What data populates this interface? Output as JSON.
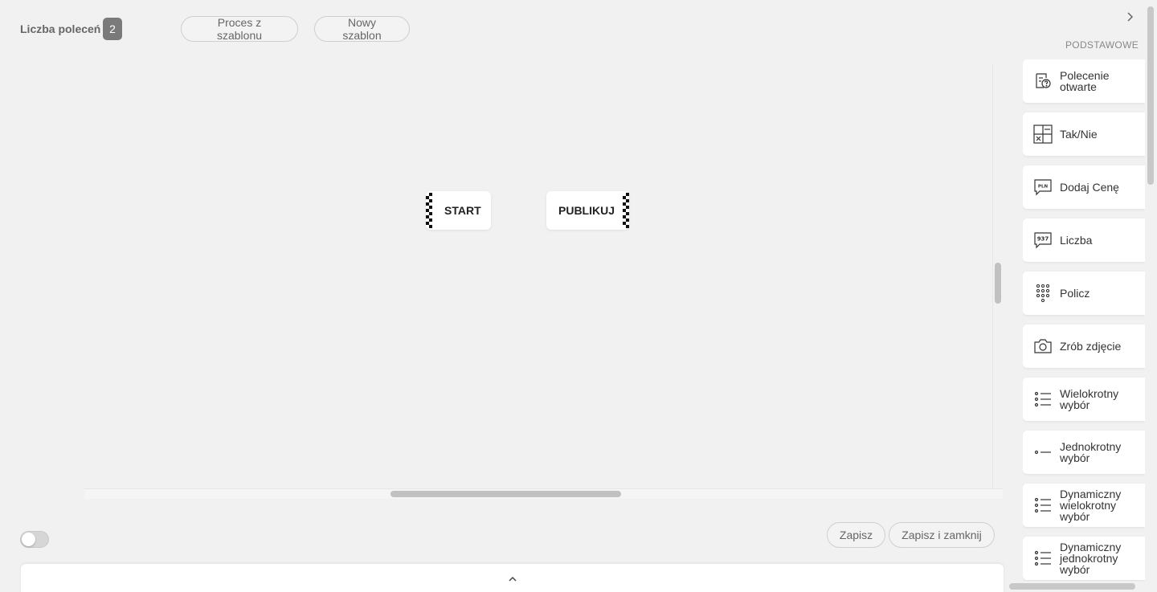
{
  "header": {
    "count_label": "Liczba poleceń",
    "count_value": "2",
    "template_process_label": "Proces z szablonu",
    "new_template_label": "Nowy szablon"
  },
  "canvas": {
    "nodes": [
      {
        "label": "START"
      },
      {
        "label": "PUBLIKUJ"
      }
    ]
  },
  "footer": {
    "toggle_on": false,
    "save_label": "Zapisz",
    "save_close_label": "Zapisz i zamknij"
  },
  "sidebar": {
    "heading": "PODSTAWOWE",
    "items": [
      {
        "label": "Polecenie otwarte",
        "icon": "open-question-icon"
      },
      {
        "label": "Tak/Nie",
        "icon": "yes-no-icon"
      },
      {
        "label": "Dodaj Cenę",
        "icon": "price-pln-icon"
      },
      {
        "label": "Liczba",
        "icon": "number-icon"
      },
      {
        "label": "Policz",
        "icon": "count-dots-icon"
      },
      {
        "label": "Zrób zdjęcie",
        "icon": "camera-icon"
      },
      {
        "label": "Wielokrotny wybór",
        "icon": "multi-choice-icon"
      },
      {
        "label": "Jednokrotny wybór",
        "icon": "single-choice-icon"
      },
      {
        "label": "Dynamiczny wielokrotny wybór",
        "icon": "dynamic-multi-choice-icon"
      },
      {
        "label": "Dynamiczny jednokrotny wybór",
        "icon": "dynamic-single-choice-icon"
      }
    ]
  },
  "colors": {
    "background": "#f1f1f1",
    "badge": "#7a7a7a",
    "card": "#ffffff"
  }
}
